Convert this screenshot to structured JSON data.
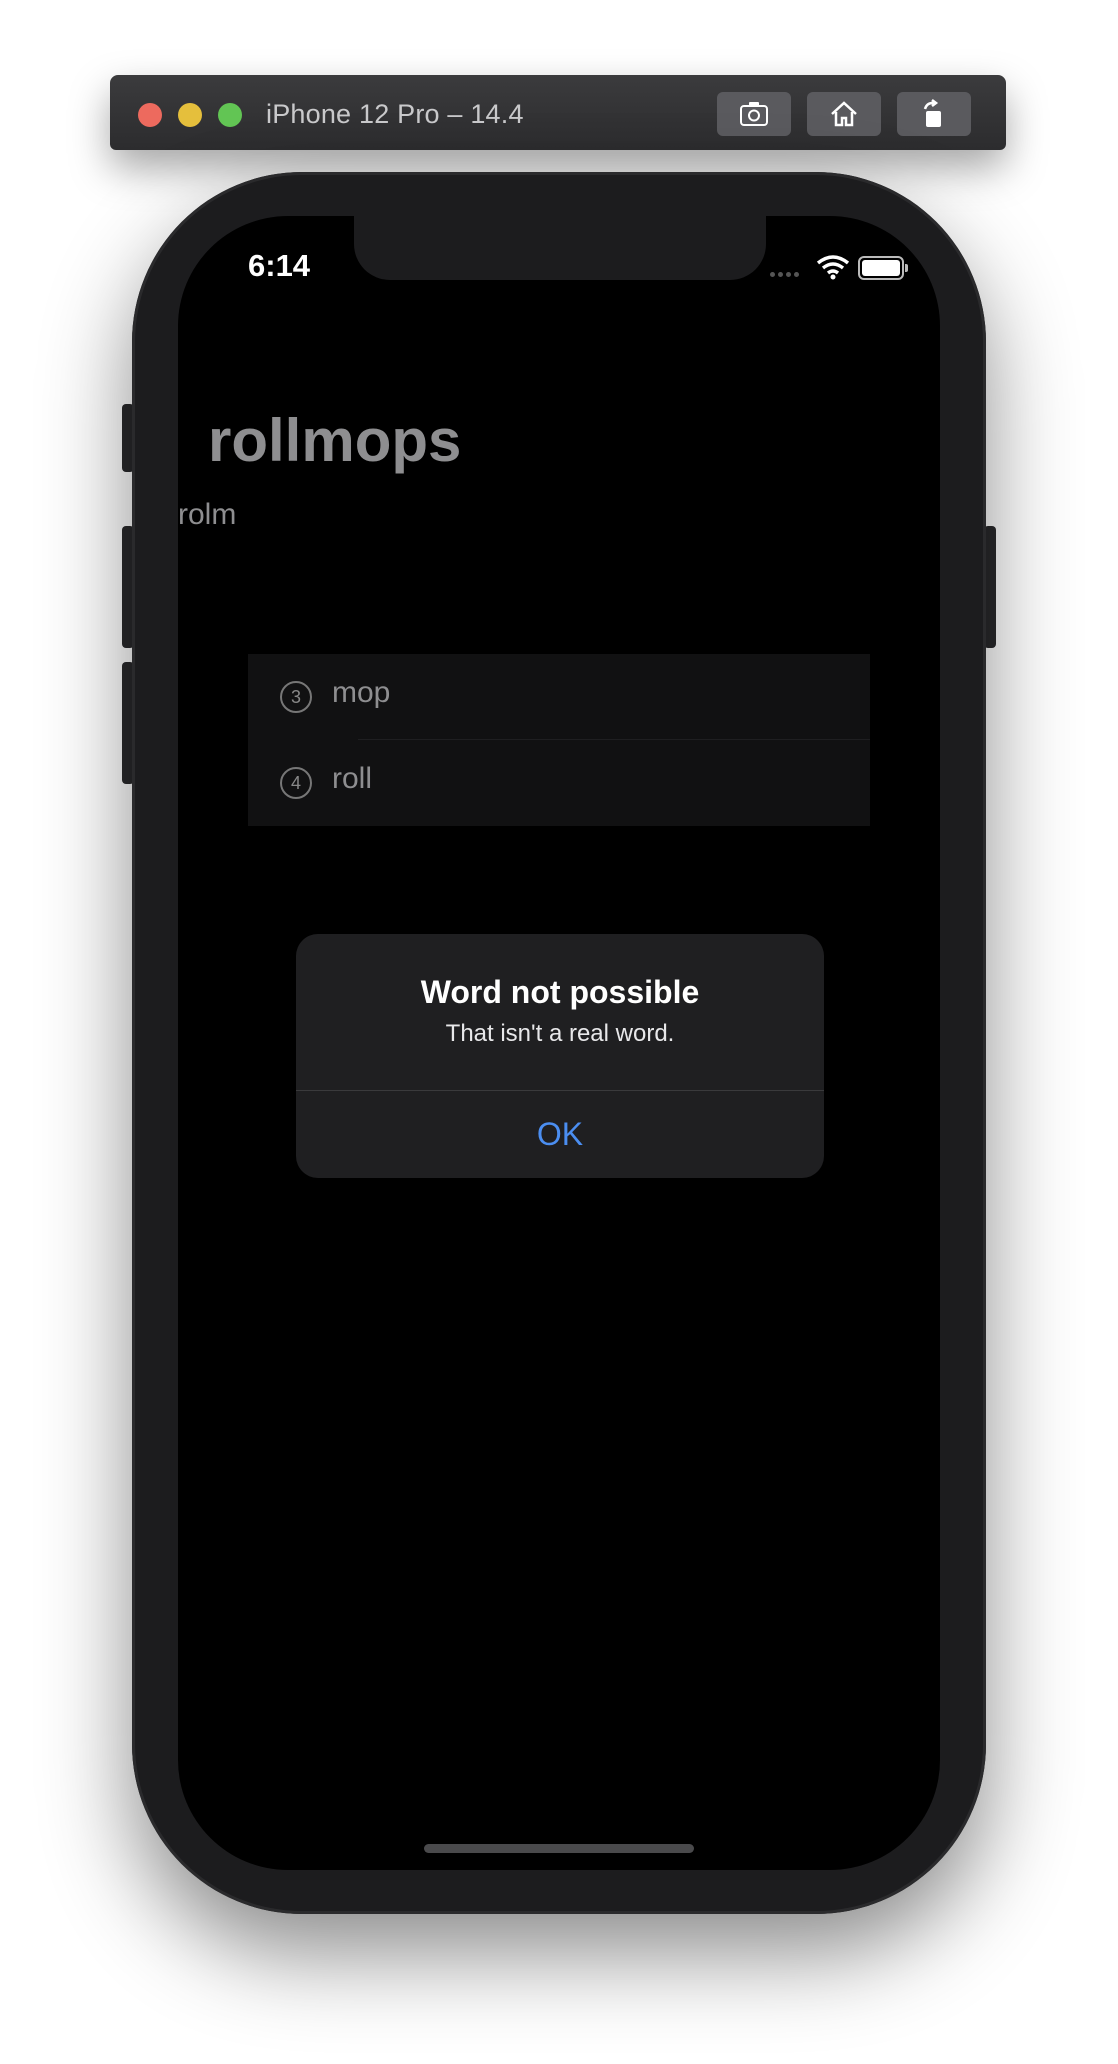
{
  "simulator": {
    "title": "iPhone 12 Pro – 14.4",
    "buttons": [
      "screenshot-icon",
      "home-icon",
      "rotate-icon"
    ],
    "traffic_lights": {
      "close": "#ed6a5e",
      "minimize": "#e5bf3c",
      "maximize": "#62c554"
    }
  },
  "status_bar": {
    "time": "6:14",
    "icons": [
      "signal-dots-icon",
      "wifi-icon",
      "battery-icon"
    ]
  },
  "app": {
    "root_word": "rollmops",
    "input_text": "rolm",
    "words": [
      {
        "length": "3",
        "word": "mop"
      },
      {
        "length": "4",
        "word": "roll"
      }
    ]
  },
  "alert": {
    "title": "Word not possible",
    "message": "That isn't a real word.",
    "ok_label": "OK"
  },
  "colors": {
    "accent": "#4b8ef1",
    "screen_background": "#000000",
    "alert_background": "#1f1f21"
  }
}
